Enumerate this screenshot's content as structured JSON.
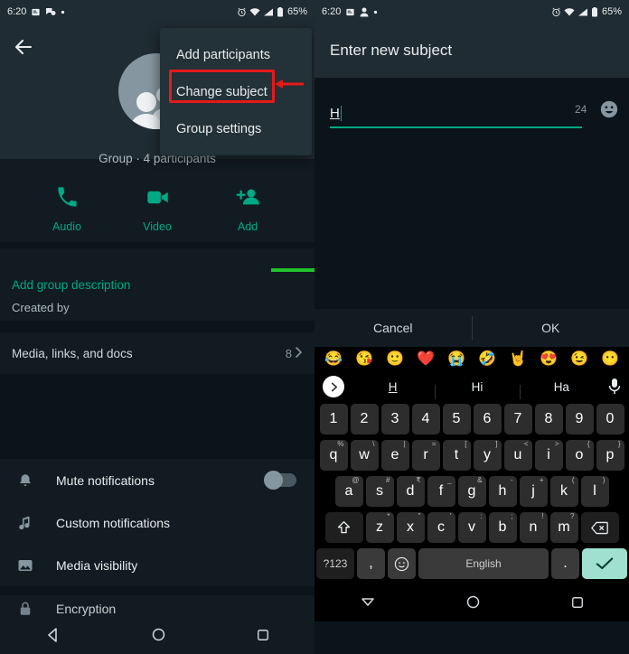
{
  "status_bar": {
    "time": "6:20",
    "battery": "65%",
    "left_icons": [
      "sim-card-icon",
      "chat-icon",
      "dot-icon"
    ],
    "right_icons": [
      "alarm-icon",
      "wifi-icon",
      "signal-icon",
      "battery-icon"
    ]
  },
  "status_bar_right": {
    "time": "6:20",
    "battery": "65%",
    "left_icons": [
      "sim-card-icon",
      "person-icon",
      "dot-icon"
    ]
  },
  "left_panel": {
    "back_label": "Back",
    "group_subtitle": "Group · 4 participants",
    "actions": [
      {
        "label": "Audio",
        "icon": "phone-icon"
      },
      {
        "label": "Video",
        "icon": "video-icon"
      },
      {
        "label": "Add",
        "icon": "person-add-icon"
      }
    ],
    "description_link": "Add group description",
    "created_by": "Created by",
    "media_row": {
      "label": "Media, links, and docs",
      "count": "8"
    },
    "settings": [
      {
        "label": "Mute notifications",
        "icon": "bell-icon",
        "toggle": "off"
      },
      {
        "label": "Custom notifications",
        "icon": "music-note-icon"
      },
      {
        "label": "Media visibility",
        "icon": "image-icon"
      }
    ],
    "settings_partial": {
      "label": "Encryption",
      "icon": "lock-icon"
    },
    "menu": {
      "items": [
        "Add participants",
        "Change subject",
        "Group settings"
      ],
      "highlighted": "Change subject"
    }
  },
  "right_panel": {
    "header_title": "Enter new subject",
    "input": {
      "value": "H",
      "placeholder": "",
      "counter": "24"
    },
    "emoji_button": "emoji-icon",
    "buttons": {
      "cancel": "Cancel",
      "ok": "OK"
    }
  },
  "keyboard": {
    "emoji_strip": [
      "😂",
      "😘",
      "🙂",
      "❤️",
      "😭",
      "🤣",
      "🤘",
      "😍",
      "😉",
      "😶"
    ],
    "suggestions": [
      "H",
      "Hi",
      "Ha"
    ],
    "row_numbers": [
      "1",
      "2",
      "3",
      "4",
      "5",
      "6",
      "7",
      "8",
      "9",
      "0"
    ],
    "row_q": [
      {
        "k": "q",
        "s": "%"
      },
      {
        "k": "w",
        "s": "\\"
      },
      {
        "k": "e",
        "s": "|"
      },
      {
        "k": "r",
        "s": "="
      },
      {
        "k": "t",
        "s": "["
      },
      {
        "k": "y",
        "s": "]"
      },
      {
        "k": "u",
        "s": "<"
      },
      {
        "k": "i",
        "s": ">"
      },
      {
        "k": "o",
        "s": "{"
      },
      {
        "k": "p",
        "s": "}"
      }
    ],
    "row_a": [
      {
        "k": "a",
        "s": "@"
      },
      {
        "k": "s",
        "s": "#"
      },
      {
        "k": "d",
        "s": "₹"
      },
      {
        "k": "f",
        "s": "_"
      },
      {
        "k": "g",
        "s": "&"
      },
      {
        "k": "h",
        "s": "-"
      },
      {
        "k": "j",
        "s": "+"
      },
      {
        "k": "k",
        "s": "("
      },
      {
        "k": "l",
        "s": ")"
      }
    ],
    "row_z": [
      {
        "k": "z",
        "s": "*"
      },
      {
        "k": "x",
        "s": "\""
      },
      {
        "k": "c",
        "s": "'"
      },
      {
        "k": "v",
        "s": ":"
      },
      {
        "k": "b",
        "s": ";"
      },
      {
        "k": "n",
        "s": "!"
      },
      {
        "k": "m",
        "s": "?"
      }
    ],
    "shift_key": "shift-icon",
    "backspace_key": "backspace-icon",
    "symbols_key": "?123",
    "comma_key": ",",
    "emoji_key": "emoji-icon",
    "space_key": "English",
    "period_key": ".",
    "enter_key": "check-icon"
  },
  "nav_bar": {
    "back": "back-triangle-icon",
    "home": "home-circle-icon",
    "recents": "recents-square-icon"
  },
  "nav_bar_right": {
    "back": "keyboard-dismiss-icon",
    "home": "home-circle-icon",
    "recents": "recents-square-icon"
  },
  "annotations": {
    "red_box_target": "Change subject",
    "red_arrow": "points-left-to-change-subject",
    "green_arrow": "points-right",
    "red_color": "#e61919",
    "green_color": "#22c32e"
  },
  "colors": {
    "accent": "#00a884",
    "panel": "#111b21",
    "header": "#1f2c33",
    "enter_key": "#9fe0d0"
  }
}
